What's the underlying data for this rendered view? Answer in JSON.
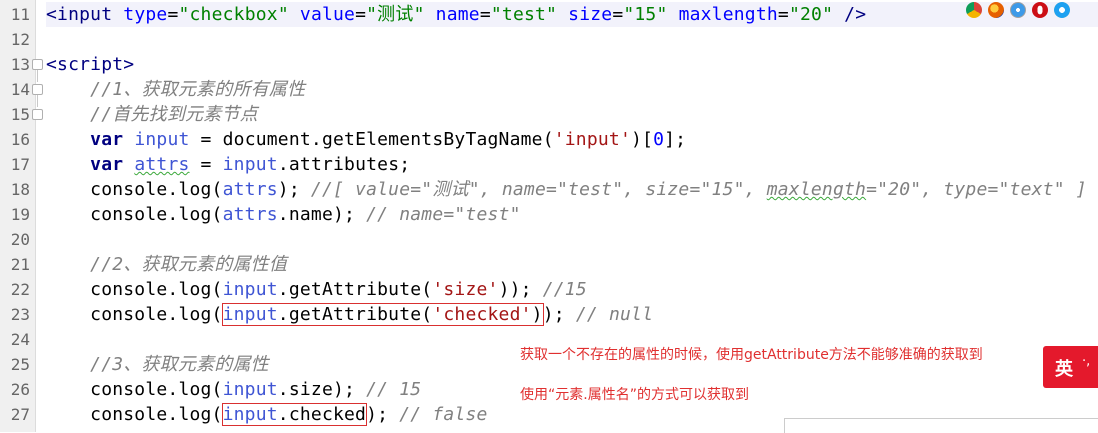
{
  "code": {
    "line_numbers": [
      "11",
      "12",
      "13",
      "14",
      "15",
      "16",
      "17",
      "18",
      "19",
      "20",
      "21",
      "22",
      "23",
      "24",
      "25",
      "26",
      "27"
    ],
    "l11": {
      "lt": "<",
      "tag": "input",
      "a1": "type",
      "eq": "=",
      "v1": "\"checkbox\"",
      "a2": "value",
      "v2": "\"测试\"",
      "a3": "name",
      "v3": "\"test\"",
      "a4": "size",
      "v4": "\"15\"",
      "a5": "maxlength",
      "v5": "\"20\"",
      "close": "/>"
    },
    "l13": {
      "open": "<",
      "tag": "script",
      "close": ">"
    },
    "l14": {
      "comment": "//1、获取元素的所有属性"
    },
    "l15": {
      "comment": "//首先找到元素节点"
    },
    "l16": {
      "kw": "var",
      "var": "input",
      "op": " = document.getElementsByTagName(",
      "str": "'input'",
      "rest": ")[",
      "num": "0",
      "end": "];"
    },
    "l17": {
      "kw": "var",
      "var": "attrs",
      "op": " = ",
      "var2": "input",
      "rest": ".attributes;"
    },
    "l18": {
      "head": "console.log(",
      "var": "attrs",
      "rest": "); ",
      "c1": "//[ value=\"测试\", name=\"test\", size=\"15\", ",
      "csq": "maxlength",
      "c2": "=\"20\", type=\"text\" ]"
    },
    "l19": {
      "head": "console.log(",
      "var": "attrs",
      "rest": ".name); ",
      "comment": "// name=\"test\""
    },
    "l21": {
      "comment": "//2、获取元素的属性值"
    },
    "l22": {
      "head": "console.log(",
      "var": "input",
      "mid": ".getAttribute(",
      "str": "'size'",
      "rest": ")); ",
      "comment": "//15"
    },
    "l23": {
      "head": "console.log(",
      "var": "input",
      "mid": ".getAttribute(",
      "str": "'checked'",
      "close": ")",
      "rest": "); ",
      "comment": "// null"
    },
    "l25": {
      "comment": "//3、获取元素的属性"
    },
    "l26": {
      "head": "console.log(",
      "var": "input",
      "rest": ".size); ",
      "comment": "// 15"
    },
    "l27": {
      "head": "console.log(",
      "var": "input",
      "mid": ".checked",
      "rest": "); ",
      "comment": "// false"
    }
  },
  "annotations": {
    "note1": "获取一个不存在的属性的时候，使用getAttribute方法不能够准确的获取到",
    "note2": "使用“元素.属性名”的方式可以获取到"
  },
  "browser_icons": [
    "chrome-icon",
    "firefox-icon",
    "safari-icon",
    "opera-icon",
    "ie-icon"
  ],
  "ime": {
    "char": "英",
    "dots": "·,"
  },
  "colors": {
    "tag": "#000080",
    "attr_value": "#008000",
    "string": "#a31515",
    "comment": "#808080",
    "highlight_box": "#d93030",
    "note": "#e03030",
    "ime": "#e4192c"
  }
}
